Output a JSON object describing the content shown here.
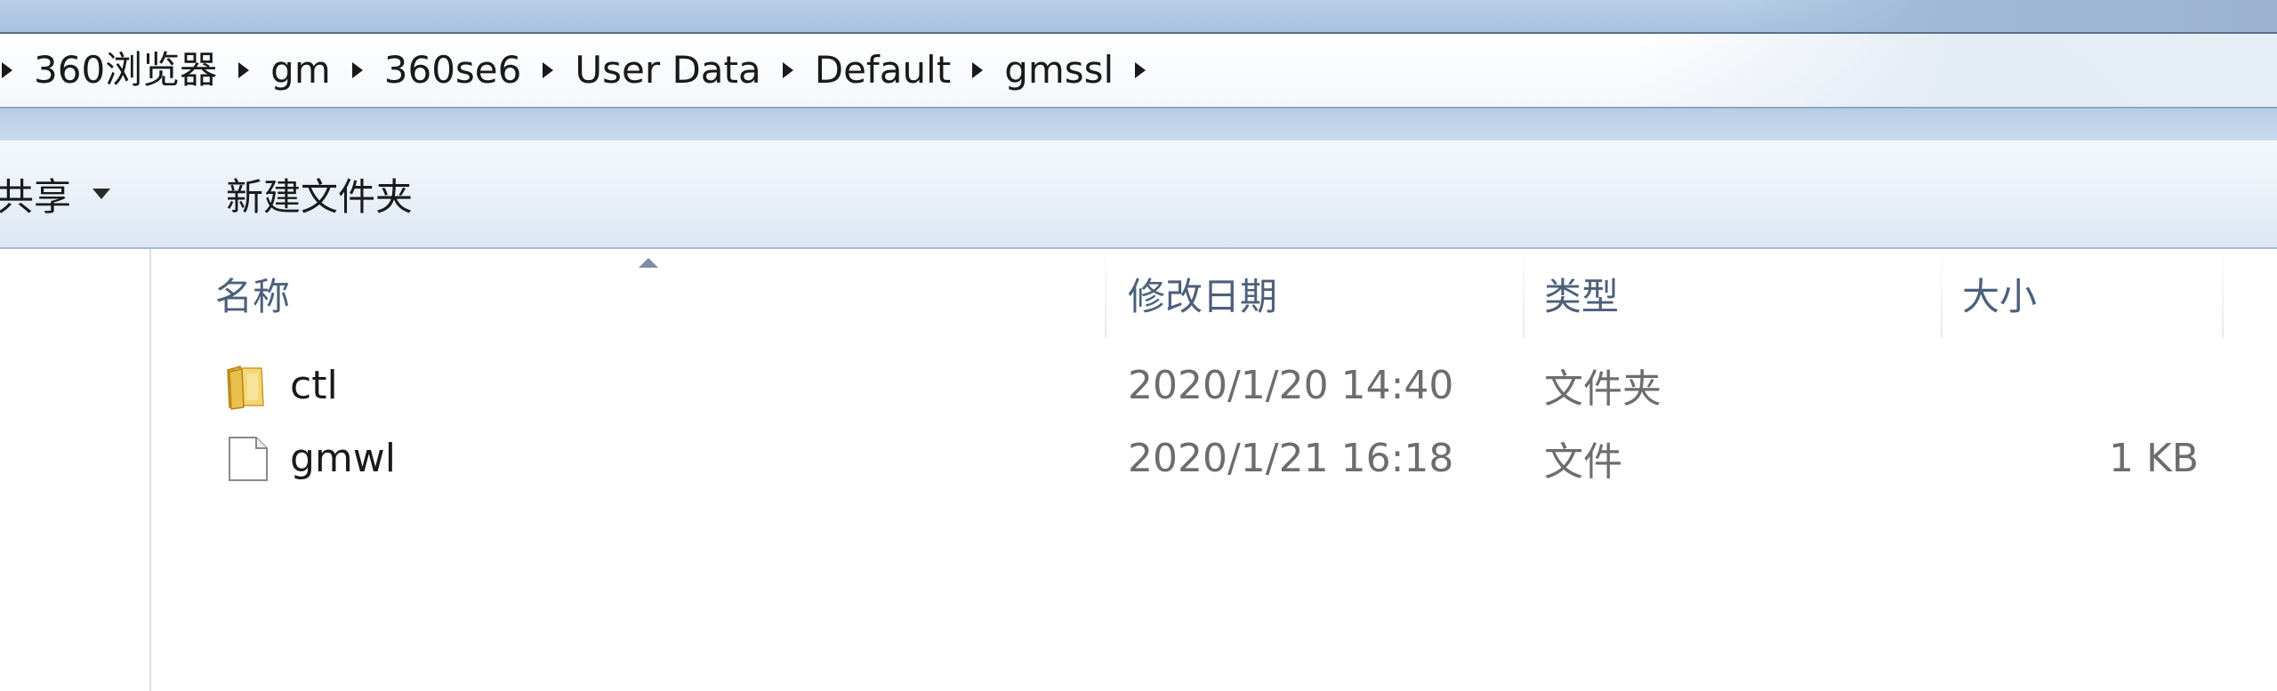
{
  "address_bar": {
    "breadcrumbs": [
      "360浏览器",
      "gm",
      "360se6",
      "User Data",
      "Default",
      "gmssl"
    ]
  },
  "toolbar": {
    "share_label": "共享",
    "new_folder_label": "新建文件夹"
  },
  "columns": {
    "name": "名称",
    "modified": "修改日期",
    "type": "类型",
    "size": "大小"
  },
  "files": [
    {
      "name": "ctl",
      "modified": "2020/1/20 14:40",
      "type": "文件夹",
      "size": "",
      "icon": "folder-icon"
    },
    {
      "name": "gmwl",
      "modified": "2020/1/21 16:18",
      "type": "文件",
      "size": "1 KB",
      "icon": "file-icon"
    }
  ],
  "colors": {
    "header_text": "#4c607a",
    "meta_text": "#6d6d6d",
    "toolbar_bg": "#e9f0f8",
    "folder_yellow": "#e8c04a"
  }
}
